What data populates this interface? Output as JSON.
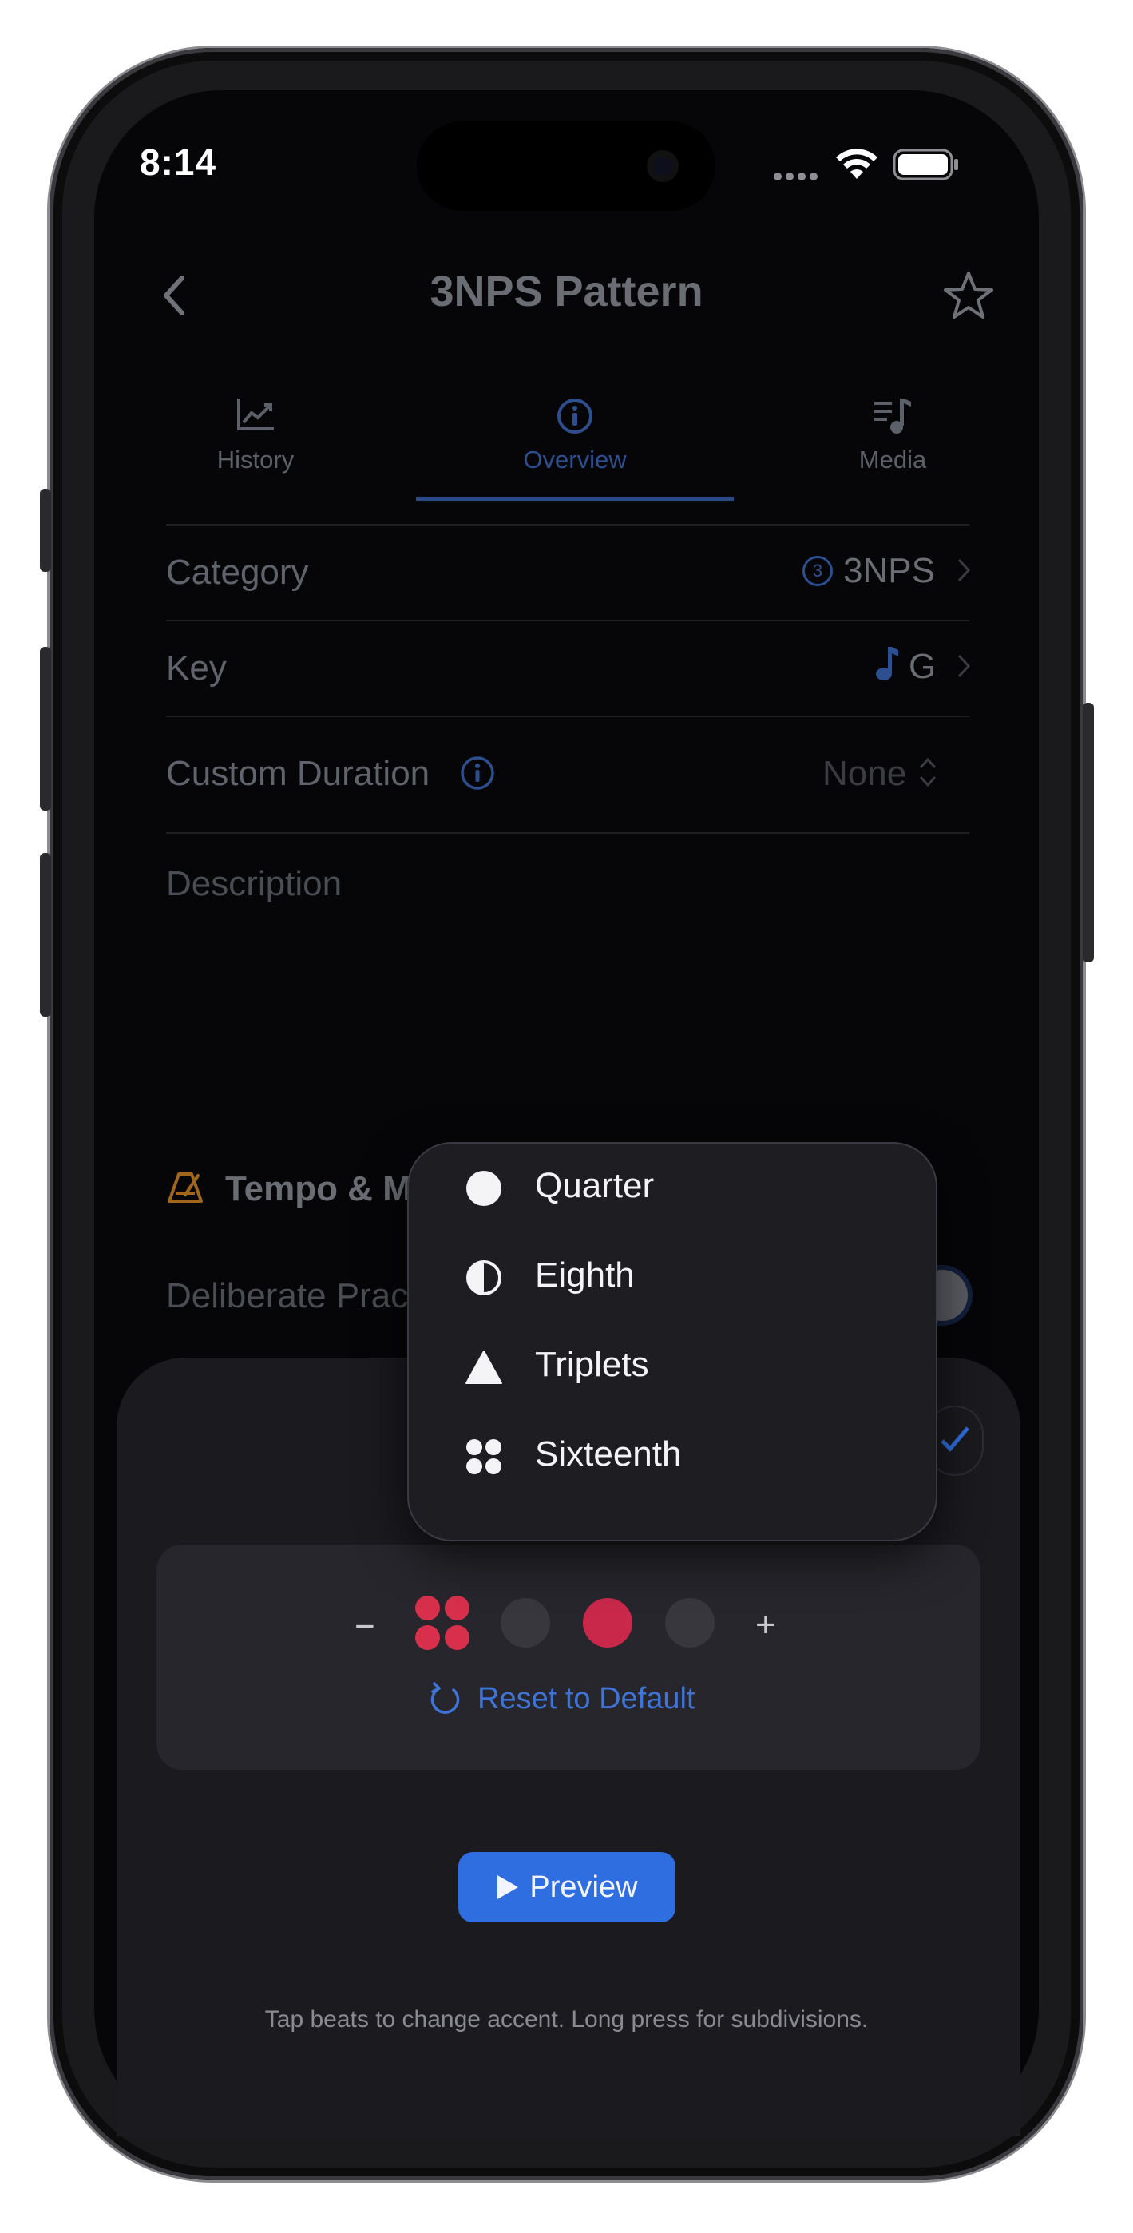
{
  "status_bar": {
    "time": "8:14"
  },
  "nav": {
    "title": "3NPS Pattern"
  },
  "tabs": [
    {
      "label": "History",
      "icon": "chart-icon",
      "selected": false
    },
    {
      "label": "Overview",
      "icon": "info-icon",
      "selected": true
    },
    {
      "label": "Media",
      "icon": "music-list-icon",
      "selected": false
    }
  ],
  "rows": {
    "category": {
      "label": "Category",
      "value": "3NPS",
      "badge": "3"
    },
    "key": {
      "label": "Key",
      "value": "G"
    },
    "custom_duration": {
      "label": "Custom Duration",
      "value": "None"
    },
    "description": {
      "label": "Description"
    }
  },
  "tempo_section": {
    "title_visible": "Tempo & M",
    "deliberate_visible": "Deliberate Prac"
  },
  "metronome": {
    "decrement": "−",
    "increment": "+",
    "reset_label": "Reset to Default",
    "beats": [
      "sixteenth-accent",
      "normal",
      "accent",
      "normal"
    ]
  },
  "preview": {
    "label": "Preview"
  },
  "hint": "Tap beats to change accent. Long press for subdivisions.",
  "subdivision_menu": [
    {
      "label": "Quarter",
      "icon": "filled-circle-icon"
    },
    {
      "label": "Eighth",
      "icon": "half-circle-icon"
    },
    {
      "label": "Triplets",
      "icon": "triangle-icon"
    },
    {
      "label": "Sixteenth",
      "icon": "four-dots-icon"
    }
  ],
  "colors": {
    "accent_blue": "#2f6ee0",
    "beat_red": "#d8304c",
    "tempo_icon_orange": "#b07020"
  }
}
